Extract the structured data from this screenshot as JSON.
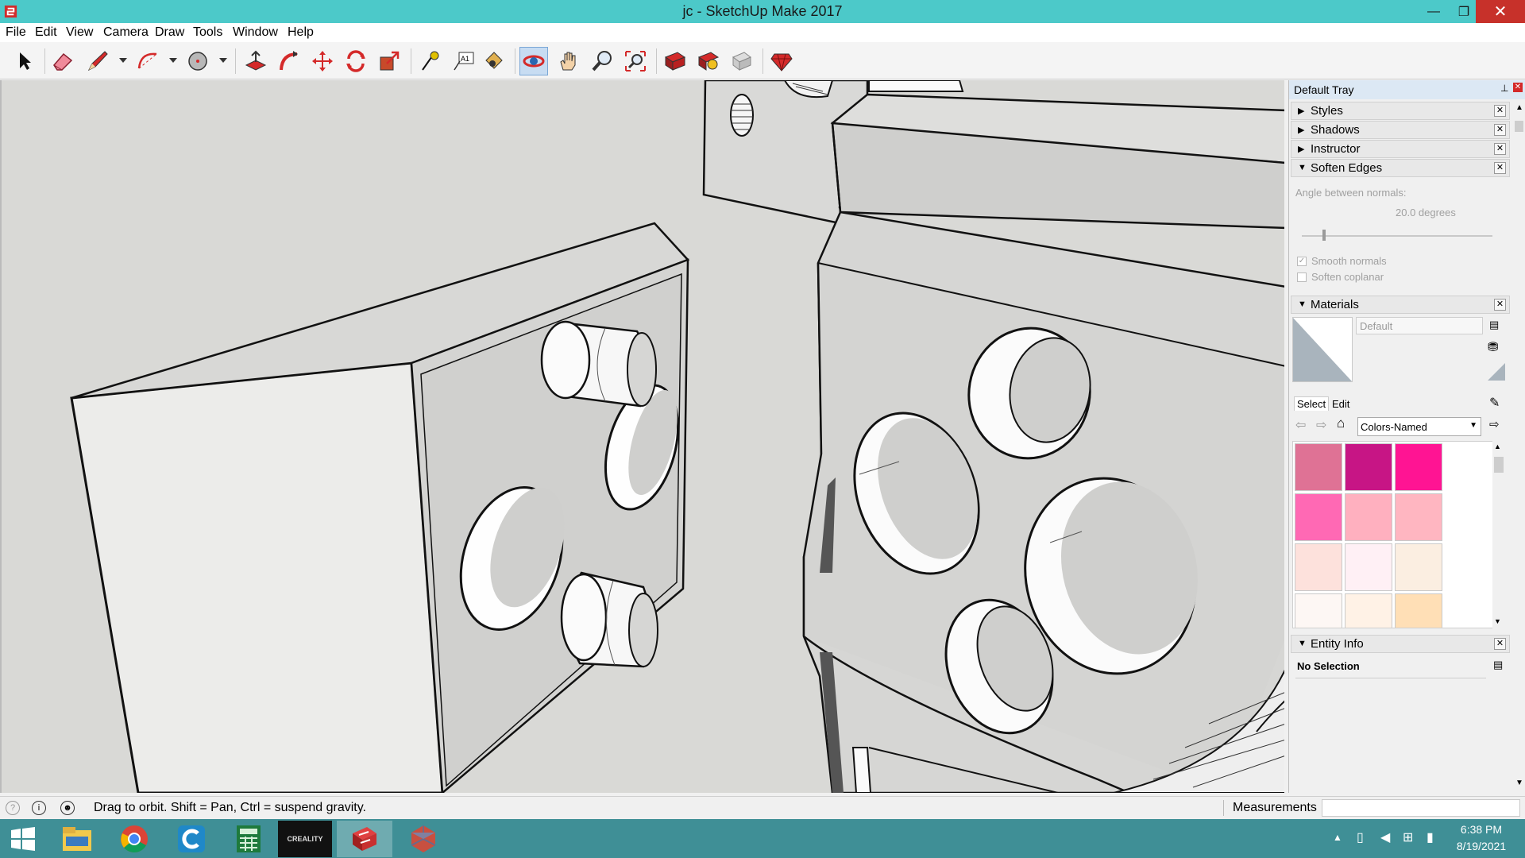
{
  "window": {
    "title": "jc - SketchUp Make 2017",
    "minimize": "—",
    "maximize": "❐",
    "close": "✕"
  },
  "menu": [
    "File",
    "Edit",
    "View",
    "Camera",
    "Draw",
    "Tools",
    "Window",
    "Help"
  ],
  "toolbar": {
    "tools": [
      "select-icon",
      "eraser-icon",
      "pencil-icon",
      "arc-icon",
      "circle-icon",
      "push-pull-icon",
      "follow-me-icon",
      "move-icon",
      "rotate-icon",
      "scale-icon",
      "tape-measure-icon",
      "text-icon",
      "paint-bucket-icon",
      "orbit-icon",
      "pan-icon",
      "zoom-icon",
      "zoom-extents-icon",
      "warehouse-icon",
      "extension-warehouse-icon",
      "layout-icon",
      "ruby-icon"
    ],
    "active": "orbit-icon"
  },
  "tray": {
    "title": "Default Tray",
    "pin": "⊥",
    "close": "✕",
    "panels": [
      {
        "label": "Styles",
        "expanded": false
      },
      {
        "label": "Shadows",
        "expanded": false
      },
      {
        "label": "Instructor",
        "expanded": false
      },
      {
        "label": "Soften Edges",
        "expanded": true
      }
    ],
    "soften": {
      "angle_label": "Angle between normals:",
      "angle_value": "20.0  degrees",
      "slider_fraction": 0.11,
      "smooth_normals": "Smooth normals",
      "smooth_checked": true,
      "soften_coplanar": "Soften coplanar",
      "coplanar_checked": false
    },
    "materials": {
      "label": "Materials",
      "name_placeholder": "Default",
      "tab_select": "Select",
      "tab_edit": "Edit",
      "collection": "Colors-Named",
      "swatches": [
        "#df7295",
        "#c71585",
        "#ff1493",
        "#ff69b4",
        "#ffb0bf",
        "#ffb6c1",
        "#fde1dc",
        "#fff0f5",
        "#fbeee1",
        "#fdf7f4",
        "#fff2e6",
        "#ffdfb6"
      ]
    },
    "entity_info": {
      "label": "Entity Info",
      "value": "No Selection"
    }
  },
  "status": {
    "hint": "Drag to orbit. Shift = Pan, Ctrl = suspend gravity.",
    "measurements_label": "Measurements",
    "measurements_value": ""
  },
  "taskbar": {
    "apps": [
      "windows-start-icon",
      "file-explorer-icon",
      "chrome-icon",
      "ccleaner-icon",
      "calculator-icon",
      "creality-icon",
      "sketchup-icon",
      "3d-app-icon"
    ],
    "creality_label": "CREALITY",
    "time": "6:38 PM",
    "date": "8/19/2021"
  }
}
